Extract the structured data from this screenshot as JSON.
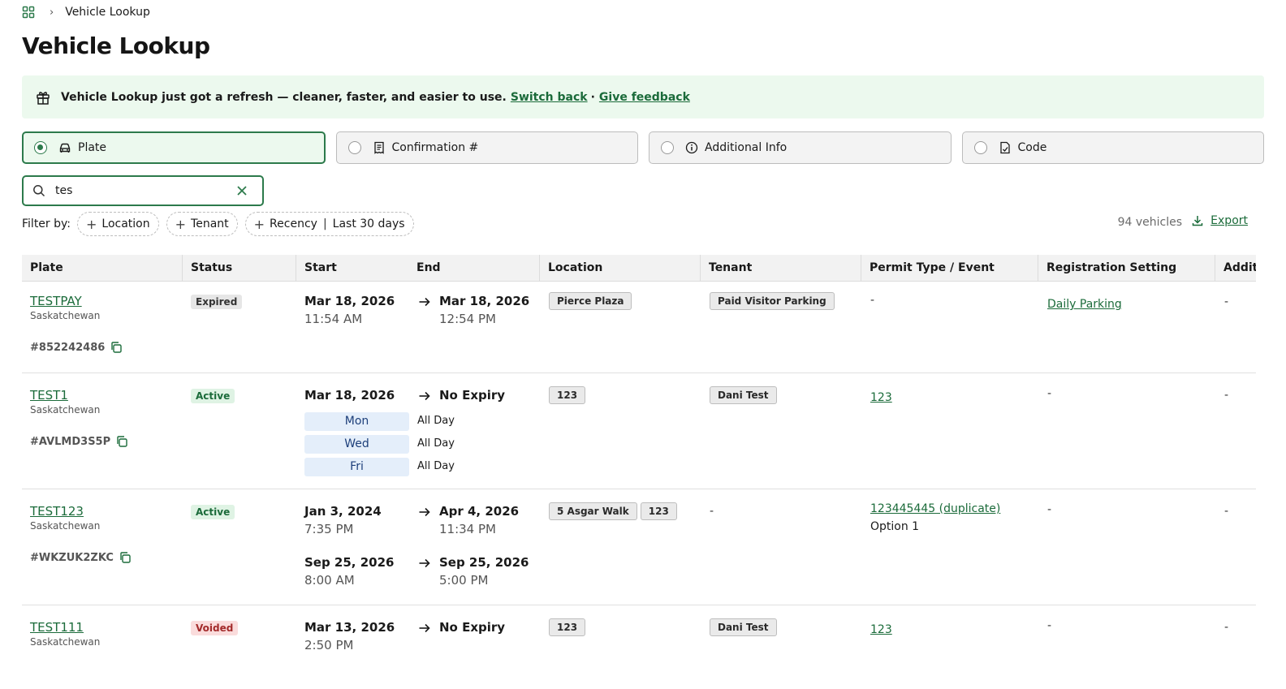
{
  "breadcrumb": {
    "current": "Vehicle Lookup"
  },
  "page": {
    "title": "Vehicle Lookup"
  },
  "banner": {
    "text": "Vehicle Lookup just got a refresh — cleaner, faster, and easier to use.",
    "switch_back": "Switch back",
    "separator": "·",
    "feedback": "Give feedback"
  },
  "search_types": [
    {
      "label": "Plate",
      "icon": "car-icon",
      "selected": true
    },
    {
      "label": "Confirmation #",
      "icon": "receipt-icon",
      "selected": false
    },
    {
      "label": "Additional Info",
      "icon": "info-icon",
      "selected": false
    },
    {
      "label": "Code",
      "icon": "code-icon",
      "selected": false
    }
  ],
  "search": {
    "value": "tes"
  },
  "filters": {
    "label": "Filter by:",
    "location": "Location",
    "tenant": "Tenant",
    "recency": "Recency",
    "recency_value": "Last 30 days"
  },
  "results": {
    "count": "94 vehicles",
    "export": "Export"
  },
  "columns": [
    "Plate",
    "Status",
    "Start",
    "End",
    "Location",
    "Tenant",
    "Permit Type / Event",
    "Registration Setting",
    "Additi"
  ],
  "rows": [
    {
      "plate": "TESTPAY",
      "province": "Saskatchewan",
      "confirmation": "#852242486",
      "status": "Expired",
      "start_date": "Mar 18, 2026",
      "start_time": "11:54 AM",
      "end_date": "Mar 18, 2026",
      "end_time": "12:54 PM",
      "locations": [
        "Pierce Plaza"
      ],
      "tenant": "Paid Visitor Parking",
      "permit": "-",
      "registration": "Daily Parking",
      "additional": "-"
    },
    {
      "plate": "TEST1",
      "province": "Saskatchewan",
      "confirmation": "#AVLMD3S5P",
      "status": "Active",
      "start_date": "Mar 18, 2026",
      "end_date": "No Expiry",
      "days": [
        {
          "day": "Mon",
          "hours": "All Day"
        },
        {
          "day": "Wed",
          "hours": "All Day"
        },
        {
          "day": "Fri",
          "hours": "All Day"
        }
      ],
      "locations": [
        "123"
      ],
      "tenant": "Dani Test",
      "permit": "123",
      "registration": "-",
      "additional": "-"
    },
    {
      "plate": "TEST123",
      "province": "Saskatchewan",
      "confirmation": "#WKZUK2ZKC",
      "status": "Active",
      "start_date": "Jan 3, 2024",
      "start_time": "7:35 PM",
      "end_date": "Apr 4, 2026",
      "end_time": "11:34 PM",
      "start_date_2": "Sep 25, 2026",
      "start_time_2": "8:00 AM",
      "end_date_2": "Sep 25, 2026",
      "end_time_2": "5:00 PM",
      "locations": [
        "5 Asgar Walk",
        "123"
      ],
      "tenant": "-",
      "permit": "123445445 (duplicate)",
      "permit_option": "Option 1",
      "registration": "-",
      "additional": "-"
    },
    {
      "plate": "TEST111",
      "province": "Saskatchewan",
      "status": "Voided",
      "start_date": "Mar 13, 2026",
      "start_time": "2:50 PM",
      "end_date": "No Expiry",
      "locations": [
        "123"
      ],
      "tenant": "Dani Test",
      "permit": "123",
      "registration": "-",
      "additional": "-"
    }
  ]
}
